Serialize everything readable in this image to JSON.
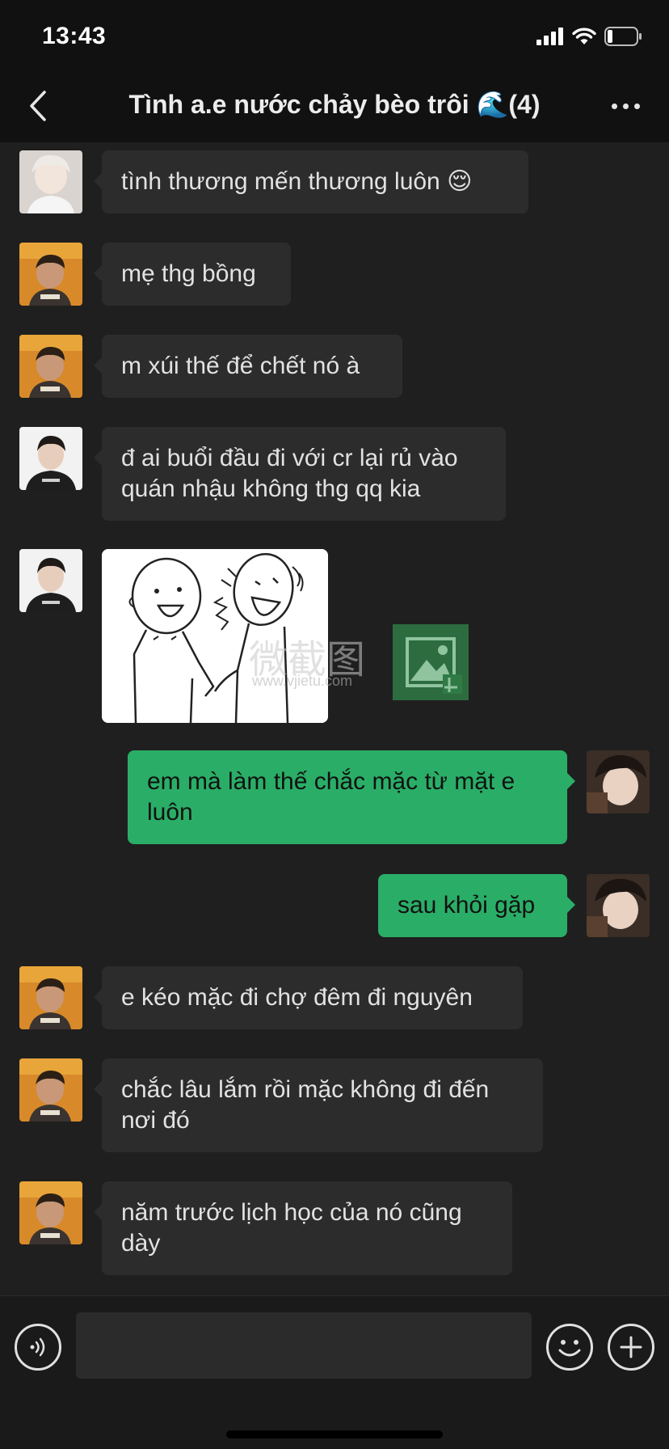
{
  "status_bar": {
    "time": "13:43"
  },
  "nav": {
    "title": "Tình a.e nước chảy bèo trôi 🌊(4)",
    "back_icon": "chevron-left-icon",
    "more_icon": "ellipsis-icon"
  },
  "messages": [
    {
      "side": "in",
      "text": "tình thương mến thương luôn 😌"
    },
    {
      "side": "in",
      "text": "mẹ thg bồng"
    },
    {
      "side": "in",
      "text": "m xúi thế để chết nó à"
    },
    {
      "side": "in",
      "text": "đ ai buổi đầu đi với cr lại rủ vào quán nhậu không thg qq kia"
    },
    {
      "side": "in",
      "type": "sticker",
      "watermark_text": "微截图",
      "watermark_url": "www.vjietu.com"
    },
    {
      "side": "out",
      "text": "em mà làm thế chắc mặc từ mặt e luôn"
    },
    {
      "side": "out",
      "text": "sau khỏi gặp"
    },
    {
      "side": "in",
      "text": "e kéo mặc đi chợ đêm đi nguyên"
    },
    {
      "side": "in",
      "text": "chắc lâu lắm rồi mặc không đi đến nơi đó"
    },
    {
      "side": "in",
      "text": "năm trước lịch học của nó cũng dày"
    }
  ],
  "input_bar": {
    "value": "",
    "placeholder": ""
  },
  "colors": {
    "background": "#111111",
    "chat_background": "#1f1f1f",
    "incoming_bubble": "#2c2c2c",
    "outgoing_bubble": "#2aae67"
  }
}
